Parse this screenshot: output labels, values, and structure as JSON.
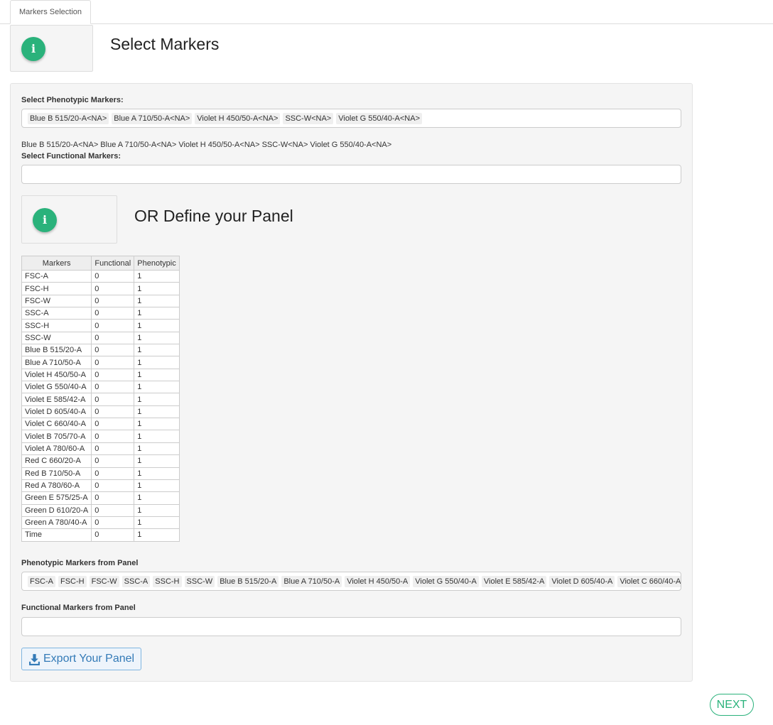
{
  "tabs": [
    {
      "label": "Markers Selection"
    }
  ],
  "header": {
    "title": "Select Markers"
  },
  "phenotypic": {
    "label": "Select Phenotypic Markers:",
    "chips": [
      "Blue B 515/20-A<NA>",
      "Blue A 710/50-A<NA>",
      "Violet H 450/50-A<NA>",
      "SSC-W<NA>",
      "Violet G 550/40-A<NA>"
    ],
    "summary": "Blue B 515/20-A<NA> Blue A 710/50-A<NA> Violet H 450/50-A<NA> SSC-W<NA> Violet G 550/40-A<NA>"
  },
  "functional": {
    "label": "Select Functional Markers:"
  },
  "define": {
    "title": "OR Define your Panel"
  },
  "table": {
    "headers": [
      "Markers",
      "Functional",
      "Phenotypic"
    ],
    "rows": [
      [
        "FSC-A",
        "0",
        "1"
      ],
      [
        "FSC-H",
        "0",
        "1"
      ],
      [
        "FSC-W",
        "0",
        "1"
      ],
      [
        "SSC-A",
        "0",
        "1"
      ],
      [
        "SSC-H",
        "0",
        "1"
      ],
      [
        "SSC-W",
        "0",
        "1"
      ],
      [
        "Blue B 515/20-A",
        "0",
        "1"
      ],
      [
        "Blue A 710/50-A",
        "0",
        "1"
      ],
      [
        "Violet H 450/50-A",
        "0",
        "1"
      ],
      [
        "Violet G 550/40-A",
        "0",
        "1"
      ],
      [
        "Violet E 585/42-A",
        "0",
        "1"
      ],
      [
        "Violet D 605/40-A",
        "0",
        "1"
      ],
      [
        "Violet C 660/40-A",
        "0",
        "1"
      ],
      [
        "Violet B 705/70-A",
        "0",
        "1"
      ],
      [
        "Violet A 780/60-A",
        "0",
        "1"
      ],
      [
        "Red C 660/20-A",
        "0",
        "1"
      ],
      [
        "Red B 710/50-A",
        "0",
        "1"
      ],
      [
        "Red A 780/60-A",
        "0",
        "1"
      ],
      [
        "Green E 575/25-A",
        "0",
        "1"
      ],
      [
        "Green D 610/20-A",
        "0",
        "1"
      ],
      [
        "Green A 780/40-A",
        "0",
        "1"
      ],
      [
        "Time",
        "0",
        "1"
      ]
    ]
  },
  "panel_pheno": {
    "label": "Phenotypic Markers from Panel",
    "chips": [
      "FSC-A",
      "FSC-H",
      "FSC-W",
      "SSC-A",
      "SSC-H",
      "SSC-W",
      "Blue B 515/20-A",
      "Blue A 710/50-A",
      "Violet H 450/50-A",
      "Violet G 550/40-A",
      "Violet E 585/42-A",
      "Violet D 605/40-A",
      "Violet C 660/40-A"
    ]
  },
  "panel_func": {
    "label": "Functional Markers from Panel"
  },
  "buttons": {
    "export": "Export Your Panel",
    "next": "NEXT"
  },
  "icons": {
    "info": "info-icon",
    "download": "download-icon"
  },
  "colors": {
    "accent_green": "#2ab27b",
    "link_blue": "#337ab7"
  }
}
